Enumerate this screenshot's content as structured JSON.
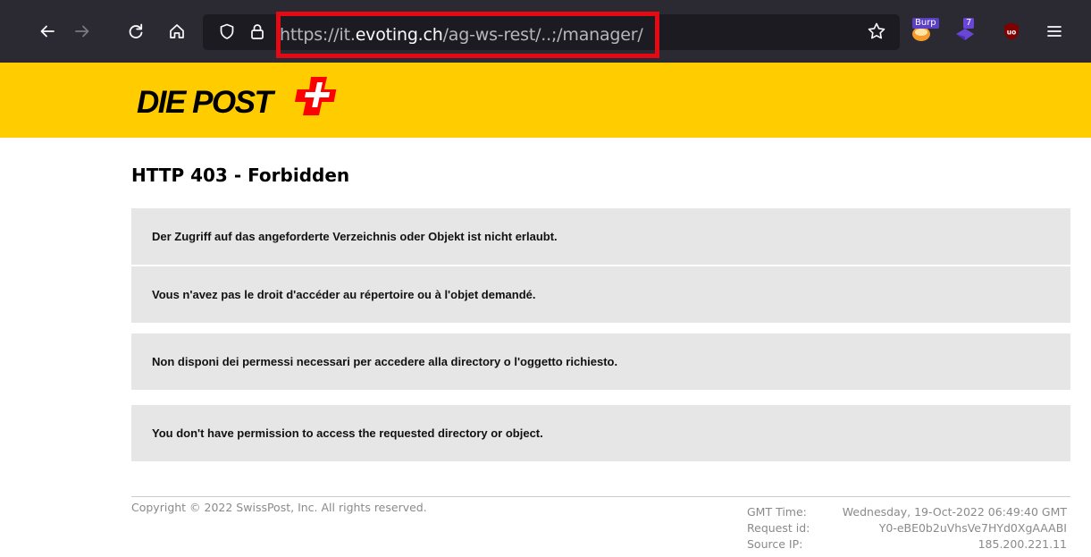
{
  "browser": {
    "url_prefix": "https://it.",
    "url_host": "evoting.ch",
    "url_path": "/ag-ws-rest/..;/manager/",
    "icons": {
      "back": "arrow-left-icon",
      "forward": "arrow-right-icon",
      "reload": "reload-icon",
      "home": "home-icon",
      "tracking": "shield-icon",
      "lock": "lock-icon",
      "bookmark": "star-icon",
      "burp": "burp-extension-icon",
      "ext2": "cube-extension-icon",
      "ublock": "ublock-icon",
      "menu": "hamburger-menu-icon"
    },
    "extensions": {
      "burp_badge": "Burp",
      "cube_badge": "7"
    },
    "highlight_color": "#e50914"
  },
  "header": {
    "logo_text": "DIE POST",
    "brand_color": "#ffcc00",
    "cross_color": "#ff0000"
  },
  "page": {
    "title": "HTTP 403 - Forbidden",
    "messages": [
      "Der Zugriff auf das angeforderte Verzeichnis oder Objekt ist nicht erlaubt.",
      "Vous n'avez pas le droit d'accéder au répertoire ou à l'objet demandé.",
      "Non disponi dei permessi necessari per accedere alla directory o l'oggetto richiesto.",
      "You don't have permission to access the requested directory or object."
    ]
  },
  "footer": {
    "copyright": "Copyright © 2022 SwissPost, Inc. All rights reserved.",
    "gmt_label": "GMT Time:",
    "gmt_value": "Wednesday, 19-Oct-2022 06:49:40 GMT",
    "request_label": "Request id:",
    "request_value": "Y0-eBE0b2uVhsVe7HYd0XgAAABI",
    "source_label": "Source IP:",
    "source_value": "185.200.221.11"
  }
}
